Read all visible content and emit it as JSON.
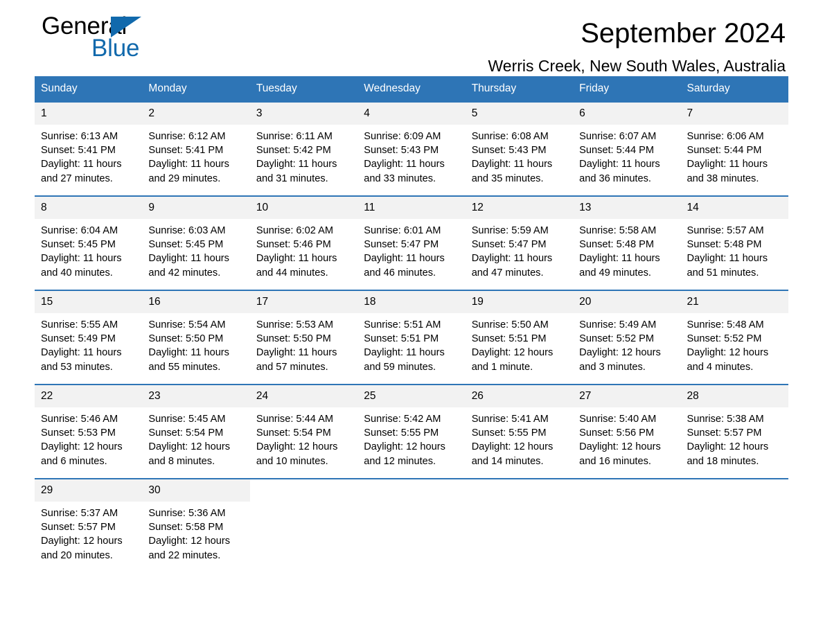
{
  "brand": {
    "name_part1": "General",
    "name_part2": "Blue",
    "triangle_icon": "triangle-icon",
    "color_black": "#000000",
    "color_blue": "#1169ac"
  },
  "header": {
    "title": "September 2024",
    "location": "Werris Creek, New South Wales, Australia"
  },
  "theme": {
    "header_blue": "#2e75b6",
    "daynum_band": "#f2f2f2",
    "text": "#000000",
    "page_background": "#ffffff"
  },
  "calendar": {
    "weekday_headers": [
      "Sunday",
      "Monday",
      "Tuesday",
      "Wednesday",
      "Thursday",
      "Friday",
      "Saturday"
    ],
    "weeks": [
      [
        {
          "day": "1",
          "sunrise": "Sunrise: 6:13 AM",
          "sunset": "Sunset: 5:41 PM",
          "daylight": "Daylight: 11 hours and 27 minutes."
        },
        {
          "day": "2",
          "sunrise": "Sunrise: 6:12 AM",
          "sunset": "Sunset: 5:41 PM",
          "daylight": "Daylight: 11 hours and 29 minutes."
        },
        {
          "day": "3",
          "sunrise": "Sunrise: 6:11 AM",
          "sunset": "Sunset: 5:42 PM",
          "daylight": "Daylight: 11 hours and 31 minutes."
        },
        {
          "day": "4",
          "sunrise": "Sunrise: 6:09 AM",
          "sunset": "Sunset: 5:43 PM",
          "daylight": "Daylight: 11 hours and 33 minutes."
        },
        {
          "day": "5",
          "sunrise": "Sunrise: 6:08 AM",
          "sunset": "Sunset: 5:43 PM",
          "daylight": "Daylight: 11 hours and 35 minutes."
        },
        {
          "day": "6",
          "sunrise": "Sunrise: 6:07 AM",
          "sunset": "Sunset: 5:44 PM",
          "daylight": "Daylight: 11 hours and 36 minutes."
        },
        {
          "day": "7",
          "sunrise": "Sunrise: 6:06 AM",
          "sunset": "Sunset: 5:44 PM",
          "daylight": "Daylight: 11 hours and 38 minutes."
        }
      ],
      [
        {
          "day": "8",
          "sunrise": "Sunrise: 6:04 AM",
          "sunset": "Sunset: 5:45 PM",
          "daylight": "Daylight: 11 hours and 40 minutes."
        },
        {
          "day": "9",
          "sunrise": "Sunrise: 6:03 AM",
          "sunset": "Sunset: 5:45 PM",
          "daylight": "Daylight: 11 hours and 42 minutes."
        },
        {
          "day": "10",
          "sunrise": "Sunrise: 6:02 AM",
          "sunset": "Sunset: 5:46 PM",
          "daylight": "Daylight: 11 hours and 44 minutes."
        },
        {
          "day": "11",
          "sunrise": "Sunrise: 6:01 AM",
          "sunset": "Sunset: 5:47 PM",
          "daylight": "Daylight: 11 hours and 46 minutes."
        },
        {
          "day": "12",
          "sunrise": "Sunrise: 5:59 AM",
          "sunset": "Sunset: 5:47 PM",
          "daylight": "Daylight: 11 hours and 47 minutes."
        },
        {
          "day": "13",
          "sunrise": "Sunrise: 5:58 AM",
          "sunset": "Sunset: 5:48 PM",
          "daylight": "Daylight: 11 hours and 49 minutes."
        },
        {
          "day": "14",
          "sunrise": "Sunrise: 5:57 AM",
          "sunset": "Sunset: 5:48 PM",
          "daylight": "Daylight: 11 hours and 51 minutes."
        }
      ],
      [
        {
          "day": "15",
          "sunrise": "Sunrise: 5:55 AM",
          "sunset": "Sunset: 5:49 PM",
          "daylight": "Daylight: 11 hours and 53 minutes."
        },
        {
          "day": "16",
          "sunrise": "Sunrise: 5:54 AM",
          "sunset": "Sunset: 5:50 PM",
          "daylight": "Daylight: 11 hours and 55 minutes."
        },
        {
          "day": "17",
          "sunrise": "Sunrise: 5:53 AM",
          "sunset": "Sunset: 5:50 PM",
          "daylight": "Daylight: 11 hours and 57 minutes."
        },
        {
          "day": "18",
          "sunrise": "Sunrise: 5:51 AM",
          "sunset": "Sunset: 5:51 PM",
          "daylight": "Daylight: 11 hours and 59 minutes."
        },
        {
          "day": "19",
          "sunrise": "Sunrise: 5:50 AM",
          "sunset": "Sunset: 5:51 PM",
          "daylight": "Daylight: 12 hours and 1 minute."
        },
        {
          "day": "20",
          "sunrise": "Sunrise: 5:49 AM",
          "sunset": "Sunset: 5:52 PM",
          "daylight": "Daylight: 12 hours and 3 minutes."
        },
        {
          "day": "21",
          "sunrise": "Sunrise: 5:48 AM",
          "sunset": "Sunset: 5:52 PM",
          "daylight": "Daylight: 12 hours and 4 minutes."
        }
      ],
      [
        {
          "day": "22",
          "sunrise": "Sunrise: 5:46 AM",
          "sunset": "Sunset: 5:53 PM",
          "daylight": "Daylight: 12 hours and 6 minutes."
        },
        {
          "day": "23",
          "sunrise": "Sunrise: 5:45 AM",
          "sunset": "Sunset: 5:54 PM",
          "daylight": "Daylight: 12 hours and 8 minutes."
        },
        {
          "day": "24",
          "sunrise": "Sunrise: 5:44 AM",
          "sunset": "Sunset: 5:54 PM",
          "daylight": "Daylight: 12 hours and 10 minutes."
        },
        {
          "day": "25",
          "sunrise": "Sunrise: 5:42 AM",
          "sunset": "Sunset: 5:55 PM",
          "daylight": "Daylight: 12 hours and 12 minutes."
        },
        {
          "day": "26",
          "sunrise": "Sunrise: 5:41 AM",
          "sunset": "Sunset: 5:55 PM",
          "daylight": "Daylight: 12 hours and 14 minutes."
        },
        {
          "day": "27",
          "sunrise": "Sunrise: 5:40 AM",
          "sunset": "Sunset: 5:56 PM",
          "daylight": "Daylight: 12 hours and 16 minutes."
        },
        {
          "day": "28",
          "sunrise": "Sunrise: 5:38 AM",
          "sunset": "Sunset: 5:57 PM",
          "daylight": "Daylight: 12 hours and 18 minutes."
        }
      ],
      [
        {
          "day": "29",
          "sunrise": "Sunrise: 5:37 AM",
          "sunset": "Sunset: 5:57 PM",
          "daylight": "Daylight: 12 hours and 20 minutes."
        },
        {
          "day": "30",
          "sunrise": "Sunrise: 5:36 AM",
          "sunset": "Sunset: 5:58 PM",
          "daylight": "Daylight: 12 hours and 22 minutes."
        },
        {
          "day": "",
          "sunrise": "",
          "sunset": "",
          "daylight": ""
        },
        {
          "day": "",
          "sunrise": "",
          "sunset": "",
          "daylight": ""
        },
        {
          "day": "",
          "sunrise": "",
          "sunset": "",
          "daylight": ""
        },
        {
          "day": "",
          "sunrise": "",
          "sunset": "",
          "daylight": ""
        },
        {
          "day": "",
          "sunrise": "",
          "sunset": "",
          "daylight": ""
        }
      ]
    ]
  }
}
